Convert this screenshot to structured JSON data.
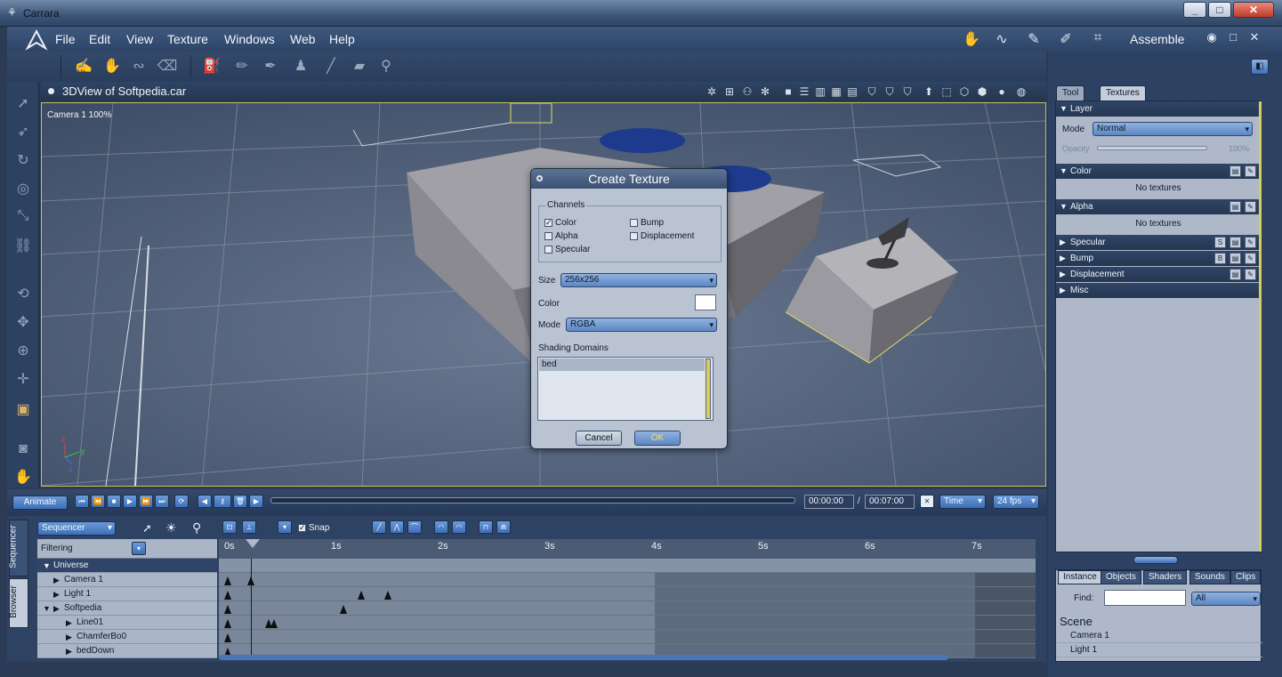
{
  "window": {
    "title": "Carrara",
    "controls": [
      "_",
      "□",
      "✕"
    ]
  },
  "menu": [
    "File",
    "Edit",
    "View",
    "Texture",
    "Windows",
    "Web",
    "Help"
  ],
  "rooms": {
    "label": "Assemble",
    "icons": [
      "hand-room-icon",
      "spline-room-icon",
      "vertex-room-icon",
      "texture-room-icon",
      "render-room-icon"
    ],
    "controls": [
      "◉",
      "□",
      "✕"
    ]
  },
  "viewport": {
    "title": "3DView of Softpedia.car",
    "camera": "Camera 1 100%"
  },
  "dialog": {
    "title": "Create Texture",
    "channels_label": "Channels",
    "channels": [
      {
        "label": "Color",
        "checked": true
      },
      {
        "label": "Bump",
        "checked": false
      },
      {
        "label": "Alpha",
        "checked": false
      },
      {
        "label": "Displacement",
        "checked": false
      },
      {
        "label": "Specular",
        "checked": false
      }
    ],
    "size_label": "Size",
    "size_value": "256x256",
    "color_label": "Color",
    "mode_label": "Mode",
    "mode_value": "RGBA",
    "shading_label": "Shading Domains",
    "domain": "bed",
    "cancel": "Cancel",
    "ok": "OK"
  },
  "animate": {
    "button": "Animate",
    "current_time": "00:00:00",
    "separator": "/",
    "end_time": "00:07:00",
    "time_mode": "Time",
    "fps": "24 fps"
  },
  "sequencer": {
    "mode": "Sequencer",
    "filtering": "Filtering",
    "snap": "Snap",
    "tabs": [
      "Sequencer",
      "Browser"
    ],
    "ticks": [
      "0s",
      "1s",
      "2s",
      "3s",
      "4s",
      "5s",
      "6s",
      "7s"
    ],
    "tracks": [
      {
        "label": "Universe",
        "level": 0,
        "expanded": true,
        "header": true
      },
      {
        "label": "Camera 1",
        "level": 1
      },
      {
        "label": "Light 1",
        "level": 1
      },
      {
        "label": "Softpedia",
        "level": 1,
        "expanded": true
      },
      {
        "label": "Line01",
        "level": 2
      },
      {
        "label": "ChamferBo0",
        "level": 2
      },
      {
        "label": "bedDown",
        "level": 2
      }
    ]
  },
  "right_panel": {
    "tabs": [
      "Tool",
      "Textures"
    ],
    "layer": "Layer",
    "mode_label": "Mode",
    "mode_value": "Normal",
    "opacity_label": "Opacity",
    "opacity_value": "100%",
    "sections": [
      {
        "label": "Color",
        "expanded": true,
        "text": "No textures"
      },
      {
        "label": "Alpha",
        "expanded": true,
        "text": "No textures"
      },
      {
        "label": "Specular",
        "expanded": false,
        "badge": "S"
      },
      {
        "label": "Bump",
        "expanded": false,
        "badge": "B"
      },
      {
        "label": "Displacement",
        "expanded": false
      },
      {
        "label": "Misc",
        "expanded": false
      }
    ],
    "bottom_tabs": [
      "Instance",
      "Objects",
      "Shaders",
      "Sounds",
      "Clips"
    ],
    "find_label": "Find:",
    "find_value": "",
    "find_scope": "All",
    "scene_title": "Scene",
    "scene_items": [
      "Camera 1",
      "Light 1"
    ]
  },
  "colors": {
    "accent": "#3d6fb6",
    "viewport_border": "#c7c25c",
    "panel": "#2d4263"
  }
}
